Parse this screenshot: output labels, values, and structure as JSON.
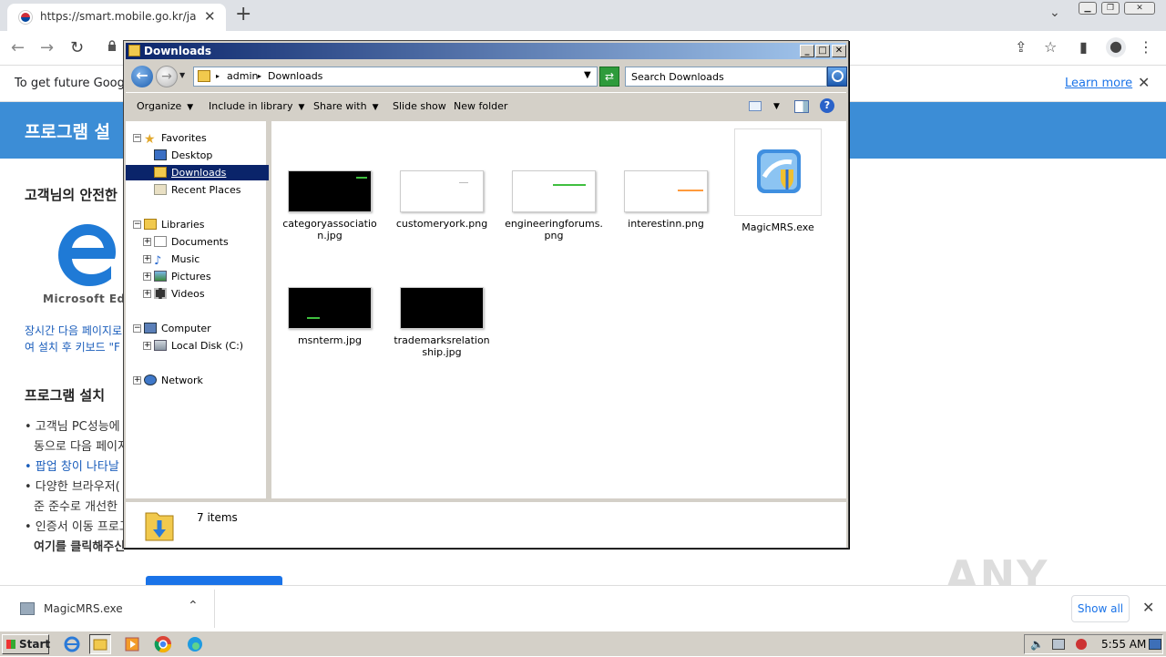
{
  "browser": {
    "tab_title": "https://smart.mobile.go.kr/java_inst",
    "url_hidden": "",
    "infobar_message": "To get future Google",
    "infobar_learn_more": "Learn more"
  },
  "page": {
    "banner_title": "프로그램 설",
    "heading1": "고객님의 안전한",
    "edge_caption": "Microsoft Edg",
    "link1": "장시간 다음 페이지로",
    "link2": "여 설치 후 키보드 \"F",
    "heading2": "프로그램 설치 ",
    "bullets": [
      "• 고객님 PC성능에",
      "동으로 다음 페이지",
      "• 팝업 창이 나타날",
      "• 다양한 브라우저(",
      "준 준수로 개선한",
      "• 인증서 이동 프로그",
      "여기를 클릭해주신"
    ]
  },
  "explorer": {
    "title": "Downloads",
    "breadcrumb": [
      "admin",
      "Downloads"
    ],
    "search_placeholder": "Search Downloads",
    "commands": [
      "Organize",
      "Include in library",
      "Share with",
      "Slide show",
      "New folder"
    ],
    "nav": {
      "favorites": "Favorites",
      "desktop": "Desktop",
      "downloads": "Downloads",
      "recent": "Recent Places",
      "libraries": "Libraries",
      "documents": "Documents",
      "music": "Music",
      "pictures": "Pictures",
      "videos": "Videos",
      "computer": "Computer",
      "local_disk": "Local Disk (C:)",
      "network": "Network"
    },
    "files": [
      {
        "name": "categoryassociation.jpg",
        "thumb": "dark",
        "accent": "#3fbf3f"
      },
      {
        "name": "customeryork.png",
        "thumb": "light",
        "accent": "#bbbbbb"
      },
      {
        "name": "engineeringforums.png",
        "thumb": "light",
        "accent": "#3fbf3f"
      },
      {
        "name": "interestinn.png",
        "thumb": "light",
        "accent": "#ff9a3c"
      },
      {
        "name": "MagicMRS.exe",
        "thumb": "exe",
        "accent": "#2a7ad8"
      },
      {
        "name": "msnterm.jpg",
        "thumb": "dark",
        "accent": "#3fbf3f"
      },
      {
        "name": "trademarksrelationship.jpg",
        "thumb": "dark",
        "accent": "#000000"
      }
    ],
    "item_count": "7 items"
  },
  "shelf": {
    "download_name": "MagicMRS.exe",
    "show_all": "Show all"
  },
  "taskbar": {
    "start": "Start",
    "clock": "5:55 AM"
  },
  "watermark": "ANY RUN"
}
